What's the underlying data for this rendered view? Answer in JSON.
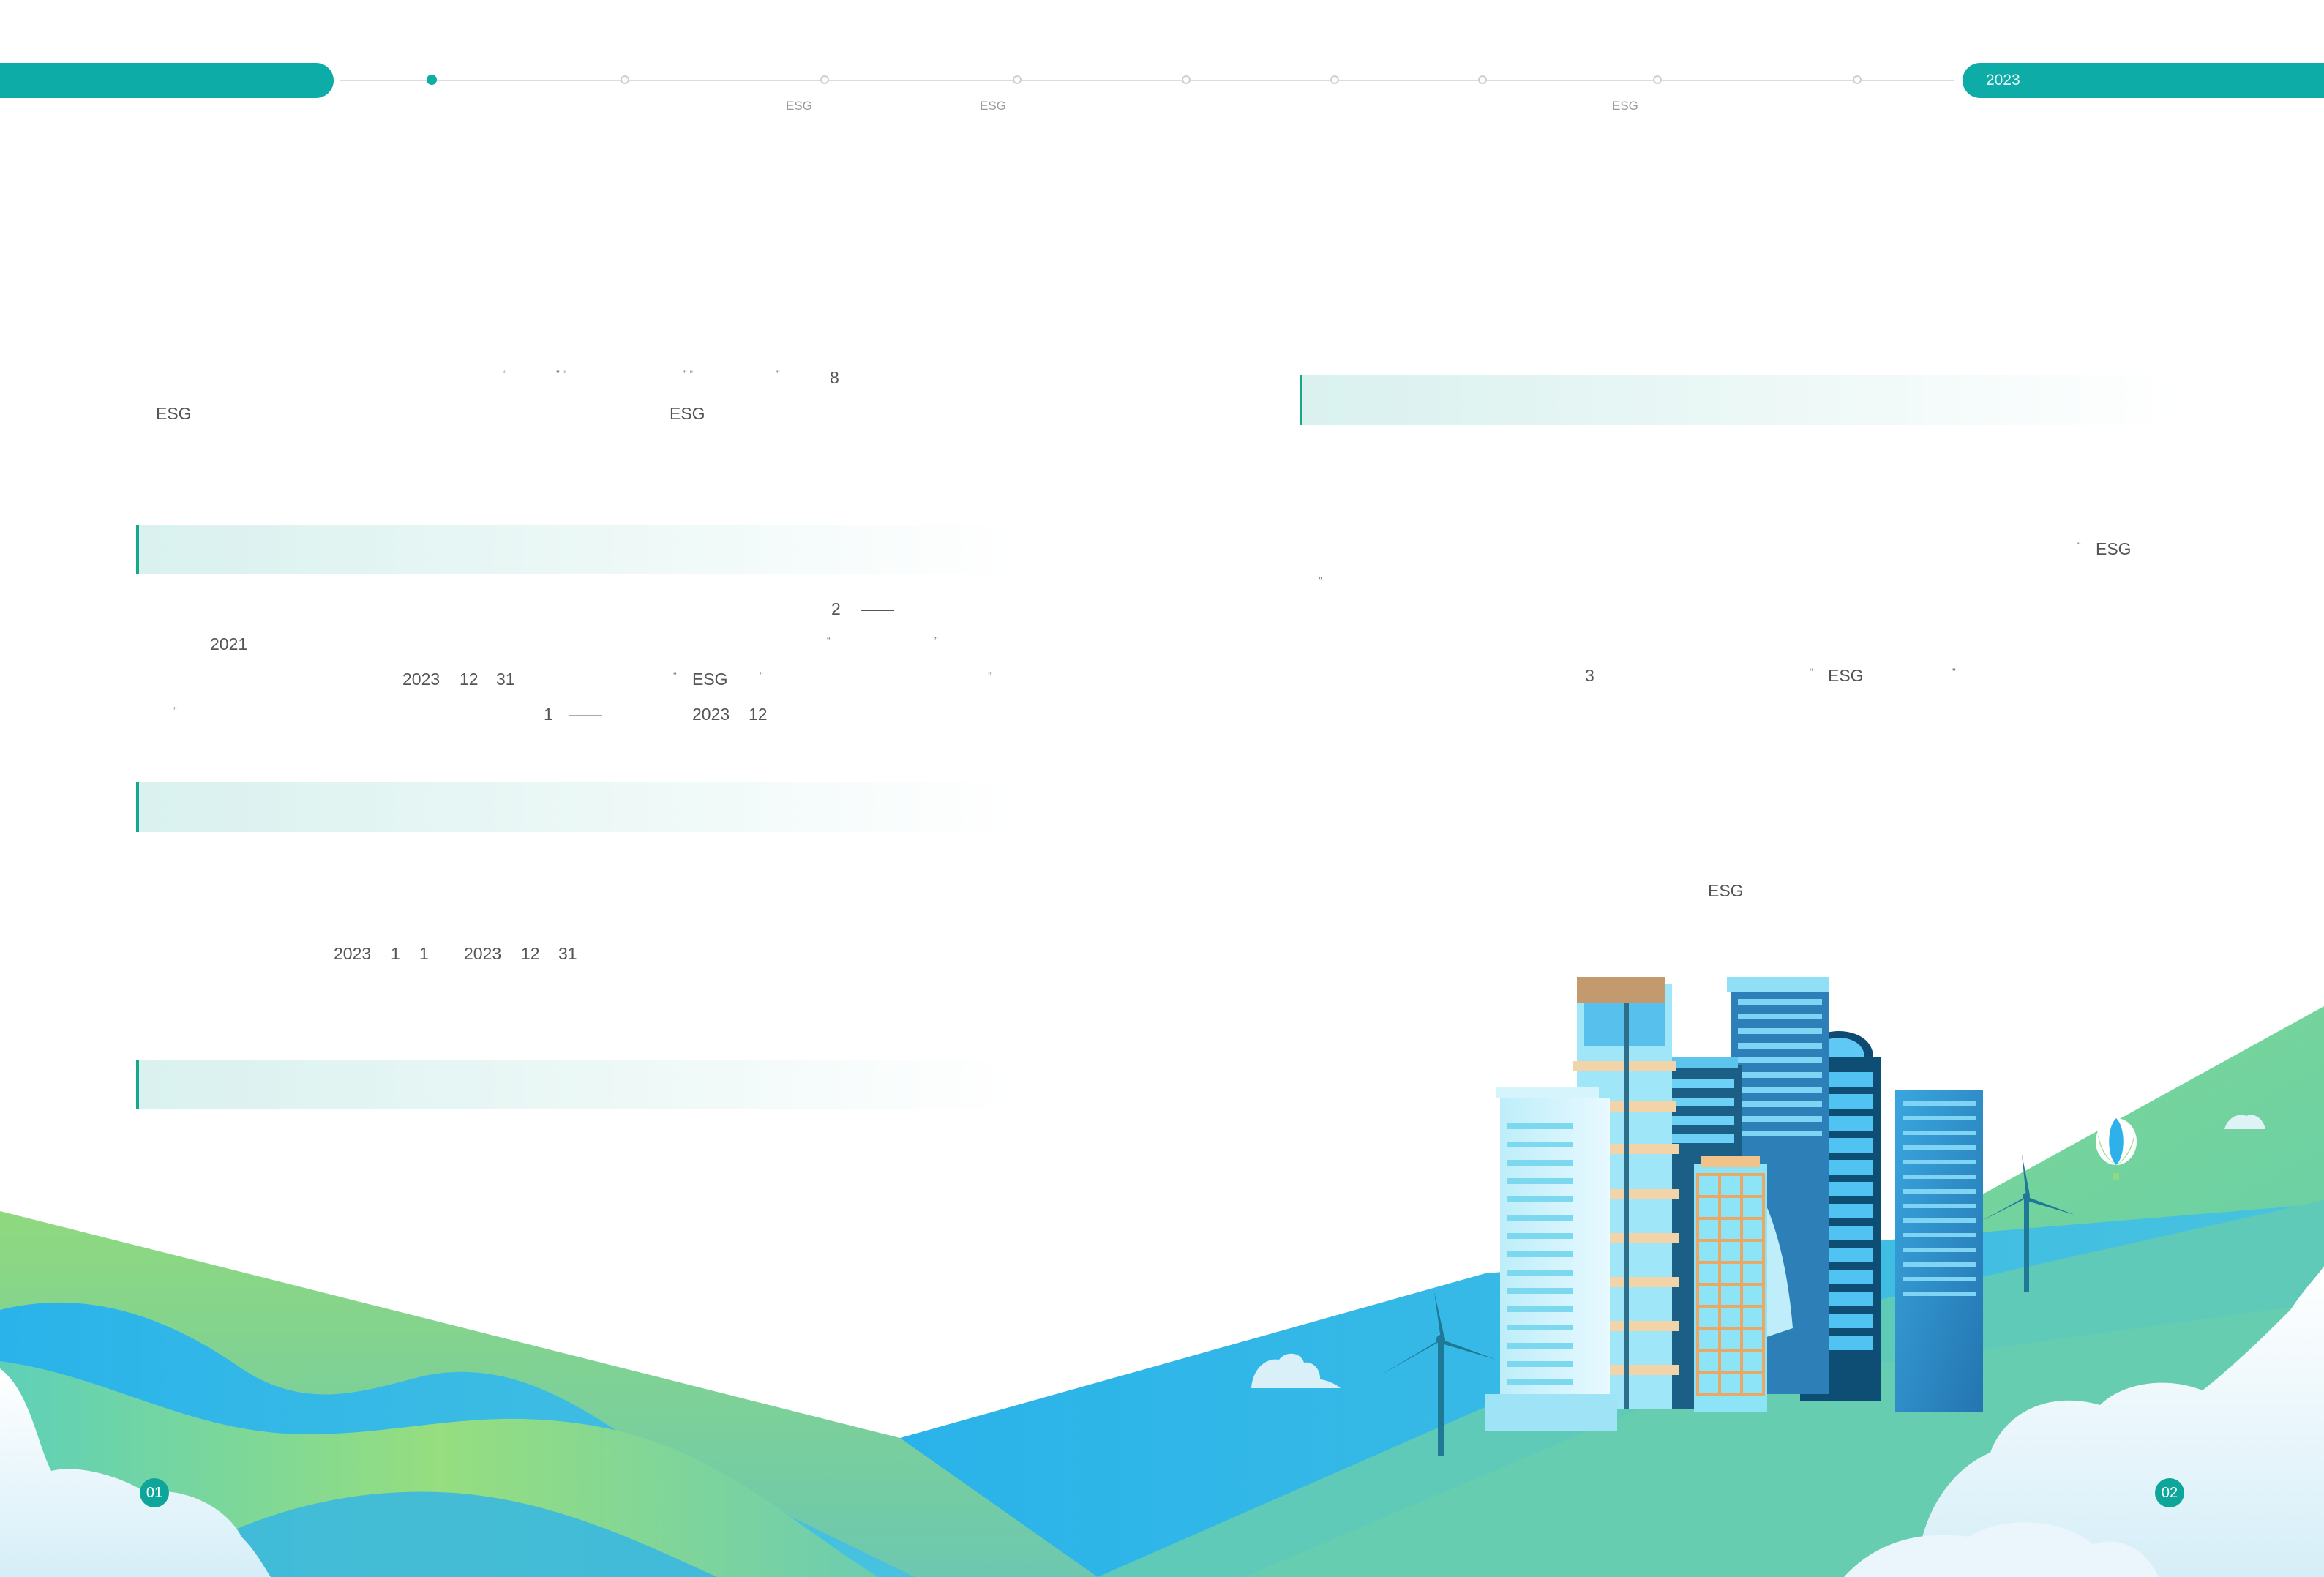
{
  "nav": {
    "year_badge": "2023",
    "labels": [
      "ESG",
      "ESG",
      "ESG"
    ]
  },
  "left": {
    "intro": {
      "line1": [
        "“",
        "” “",
        "” “",
        "”",
        "8"
      ],
      "line2": [
        "ESG",
        "ESG"
      ]
    },
    "section1": {
      "line1": [
        "2",
        "——"
      ],
      "line2": [
        "2021",
        "“",
        "”"
      ],
      "line3": [
        "2023",
        "12",
        "31",
        "“",
        "ESG",
        "”",
        "”"
      ],
      "line4": [
        "”",
        "1",
        "——",
        "2023",
        "12"
      ]
    },
    "section2": {
      "line1": [
        "2023",
        "1",
        "1",
        "2023",
        "12",
        "31"
      ]
    }
  },
  "right": {
    "section1": {
      "line1": [
        "“",
        "ESG"
      ],
      "line2": [
        "”"
      ],
      "line3": [
        "3",
        "“",
        "ESG",
        "”"
      ],
      "line4": [
        "ESG"
      ]
    }
  },
  "page_numbers": {
    "left": "01",
    "right": "02"
  },
  "colors": {
    "teal": "#0eaca6",
    "green": "#8fd97e",
    "blue": "#2eb1ea"
  }
}
